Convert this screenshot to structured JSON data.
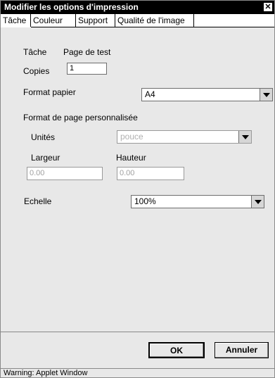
{
  "window": {
    "title": "Modifier les options d'impression",
    "close_glyph": "✕"
  },
  "tabs": [
    {
      "label": "Tâche"
    },
    {
      "label": "Couleur"
    },
    {
      "label": "Support"
    },
    {
      "label": "Qualité de l'image"
    }
  ],
  "job": {
    "task_label": "Tâche",
    "task_value": "Page de test",
    "copies_label": "Copies",
    "copies_value": "1"
  },
  "paper": {
    "format_label": "Format papier",
    "format_value": "A4"
  },
  "custom": {
    "section_label": "Format de page personnalisée",
    "units_label": "Unités",
    "units_value": "pouce",
    "width_label": "Largeur",
    "width_value": "0.00",
    "height_label": "Hauteur",
    "height_value": "0.00"
  },
  "scale": {
    "label": "Echelle",
    "value": "100%"
  },
  "buttons": {
    "ok": "OK",
    "cancel": "Annuler"
  },
  "status": "Warning: Applet Window",
  "icons": {
    "close": "close-icon",
    "dropdown": "chevron-down-icon"
  }
}
